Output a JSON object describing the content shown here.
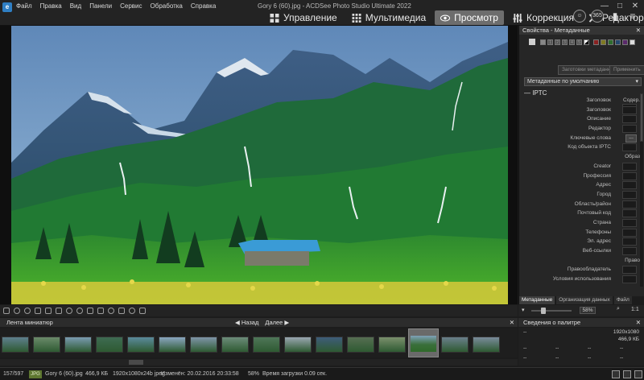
{
  "window": {
    "title": "Gory 6 (60).jpg - ACDSee Photo Studio Ultimate 2022",
    "app_icon": "acdsee-icon",
    "controls": [
      "—",
      "□",
      "✕"
    ]
  },
  "menu": [
    "Файл",
    "Правка",
    "Вид",
    "Панели",
    "Сервис",
    "Обработка",
    "Справка"
  ],
  "modes": [
    {
      "label": "Управление",
      "icon": "grid-icon",
      "active": false
    },
    {
      "label": "Мультимедиа",
      "icon": "tiles-icon",
      "active": false
    },
    {
      "label": "Просмотр",
      "icon": "eye-icon",
      "active": true
    },
    {
      "label": "Коррекция",
      "icon": "sliders-icon",
      "active": false
    },
    {
      "label": "Редактор",
      "icon": "tools-icon",
      "active": false
    }
  ],
  "top_icons": [
    "365",
    "stats-icon",
    "menu-icon"
  ],
  "panel": {
    "title": "Свойства - Метаданные",
    "close": "✕",
    "rating_labels": [
      "1",
      "2",
      "3",
      "4",
      "5"
    ],
    "template_button": "Заготовки метаданных",
    "apply_button": "Применить",
    "preset": "Метаданные по умолчанию",
    "section": "IPTC",
    "fields": [
      {
        "label": "Заголовок",
        "sec": "Содер.",
        "kind": "box"
      },
      {
        "label": "Заголовок",
        "sec": "",
        "kind": "box"
      },
      {
        "label": "Описание",
        "sec": "",
        "kind": "box"
      },
      {
        "label": "Редактор",
        "sec": "",
        "kind": "box"
      },
      {
        "label": "Ключевые слова",
        "sec": "",
        "kind": "dots"
      },
      {
        "label": "Код объекта IPTC",
        "sec": "",
        "kind": "box"
      },
      {
        "label": "",
        "sec": "Образ",
        "kind": "none"
      },
      {
        "label": "Creator",
        "sec": "",
        "kind": "box"
      },
      {
        "label": "Профессия",
        "sec": "",
        "kind": "box"
      },
      {
        "label": "Адрес",
        "sec": "",
        "kind": "box"
      },
      {
        "label": "Город",
        "sec": "",
        "kind": "box"
      },
      {
        "label": "Область/район",
        "sec": "",
        "kind": "box"
      },
      {
        "label": "Почтовый код",
        "sec": "",
        "kind": "box"
      },
      {
        "label": "Страна",
        "sec": "",
        "kind": "box"
      },
      {
        "label": "Телефоны",
        "sec": "",
        "kind": "box"
      },
      {
        "label": "Эл. адрес",
        "sec": "",
        "kind": "box"
      },
      {
        "label": "Веб-ссылки",
        "sec": "",
        "kind": "box"
      },
      {
        "label": "",
        "sec": "Право",
        "kind": "none"
      },
      {
        "label": "Правообладатель",
        "sec": "",
        "kind": "box"
      },
      {
        "label": "Условия использования",
        "sec": "",
        "kind": "box"
      }
    ],
    "tabs": [
      "Метаданные",
      "Организация данных",
      "Файл"
    ],
    "active_tab": 0
  },
  "viewer_toolbar": {
    "zoom": "58%",
    "ratio": "1:1"
  },
  "filmstrip": {
    "title": "Лента миниатюр",
    "back": "Назад",
    "next": "Далее",
    "close": "✕",
    "thumb_colors": [
      "#5e7f8e",
      "#6b8a6a",
      "#7a9bb0",
      "#3e6b52",
      "#5a8a9c",
      "#8aa6c0",
      "#7f95a8",
      "#6c8c7a",
      "#4f7658",
      "#9aa7b1",
      "#3e5c7a",
      "#566e52",
      "#7b8f6c",
      "#b0b8c0",
      "#6a7f8c",
      "#7a8b9b"
    ],
    "selected_index": 13
  },
  "palette_info": {
    "title": "Сведения о палитре",
    "close": "✕",
    "resolution": "1920x1080",
    "size": "466,9 КБ",
    "dash": "--"
  },
  "status": {
    "position": "157/597",
    "format": "JPG",
    "filename": "Gory 6 (60).jpg",
    "filesize": "466,9 КБ",
    "dimensions": "1920x1080x24b jpeg",
    "modified": "Изменён: 20.02.2016 20:33:58",
    "zoom": "58%",
    "load_time": "Время загрузки 0.09 сек."
  }
}
